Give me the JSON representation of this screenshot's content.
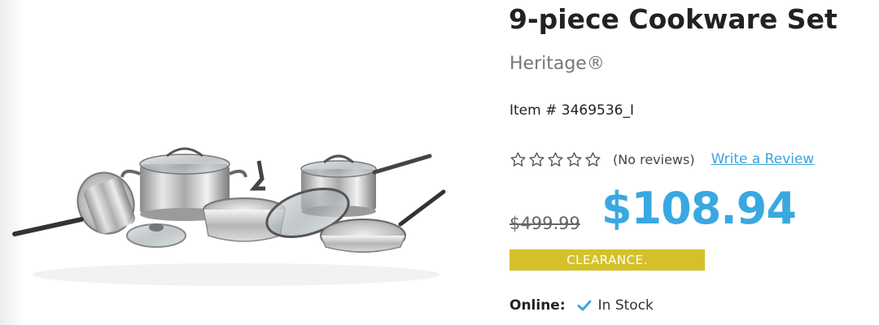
{
  "product": {
    "title": "9-piece Cookware Set",
    "brand": "Heritage®",
    "item_number": "Item # 3469536_I",
    "image_icon": "cookware-set-image"
  },
  "rating": {
    "stars_filled": 0,
    "stars_total": 5,
    "reviews_text": "(No reviews)",
    "write_review_label": "Write a Review"
  },
  "pricing": {
    "original_price": "$499.99",
    "sale_price": "$108.94",
    "badge": "CLEARANCE."
  },
  "availability": {
    "label": "Online:",
    "status": "In Stock",
    "status_icon": "check-icon"
  },
  "colors": {
    "price_blue": "#3aa8e0",
    "link_blue": "#3aa3d8",
    "clearance_gold": "#d4c12a"
  }
}
